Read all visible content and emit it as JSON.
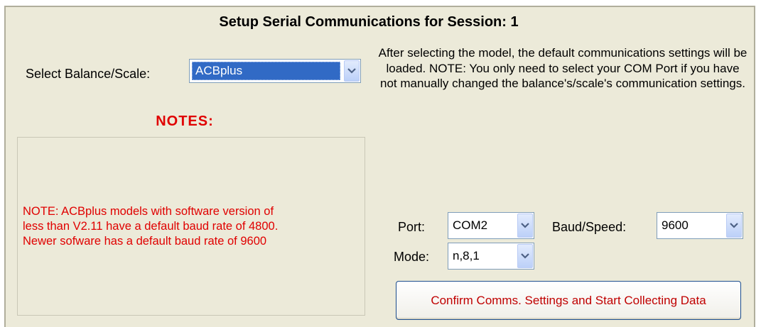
{
  "header": {
    "title": "Setup Serial Communications for Session: 1"
  },
  "balance": {
    "label": "Select Balance/Scale:",
    "selected": "ACBplus"
  },
  "info_text": "After selecting the model, the default communications settings will be loaded. NOTE: You only need to select your COM Port if you have not manually changed the balance's/scale's communication settings.",
  "notes": {
    "title": "NOTES:",
    "lines": [
      "NOTE: ACBplus models with software version of",
      "less than V2.11 have a default baud rate of 4800.",
      "Newer sofware has a default baud rate of 9600"
    ]
  },
  "port": {
    "label": "Port:",
    "selected": "COM2"
  },
  "baud": {
    "label": "Baud/Speed:",
    "selected": "9600"
  },
  "mode": {
    "label": "Mode:",
    "selected": "n,8,1"
  },
  "confirm_button": {
    "label": "Confirm Comms. Settings and Start Collecting Data"
  },
  "colors": {
    "panel_bg": "#ecead9",
    "notes_red": "#e00000",
    "selection_blue": "#316ac5"
  },
  "icons": {
    "dropdown": "chevron-down-icon"
  }
}
